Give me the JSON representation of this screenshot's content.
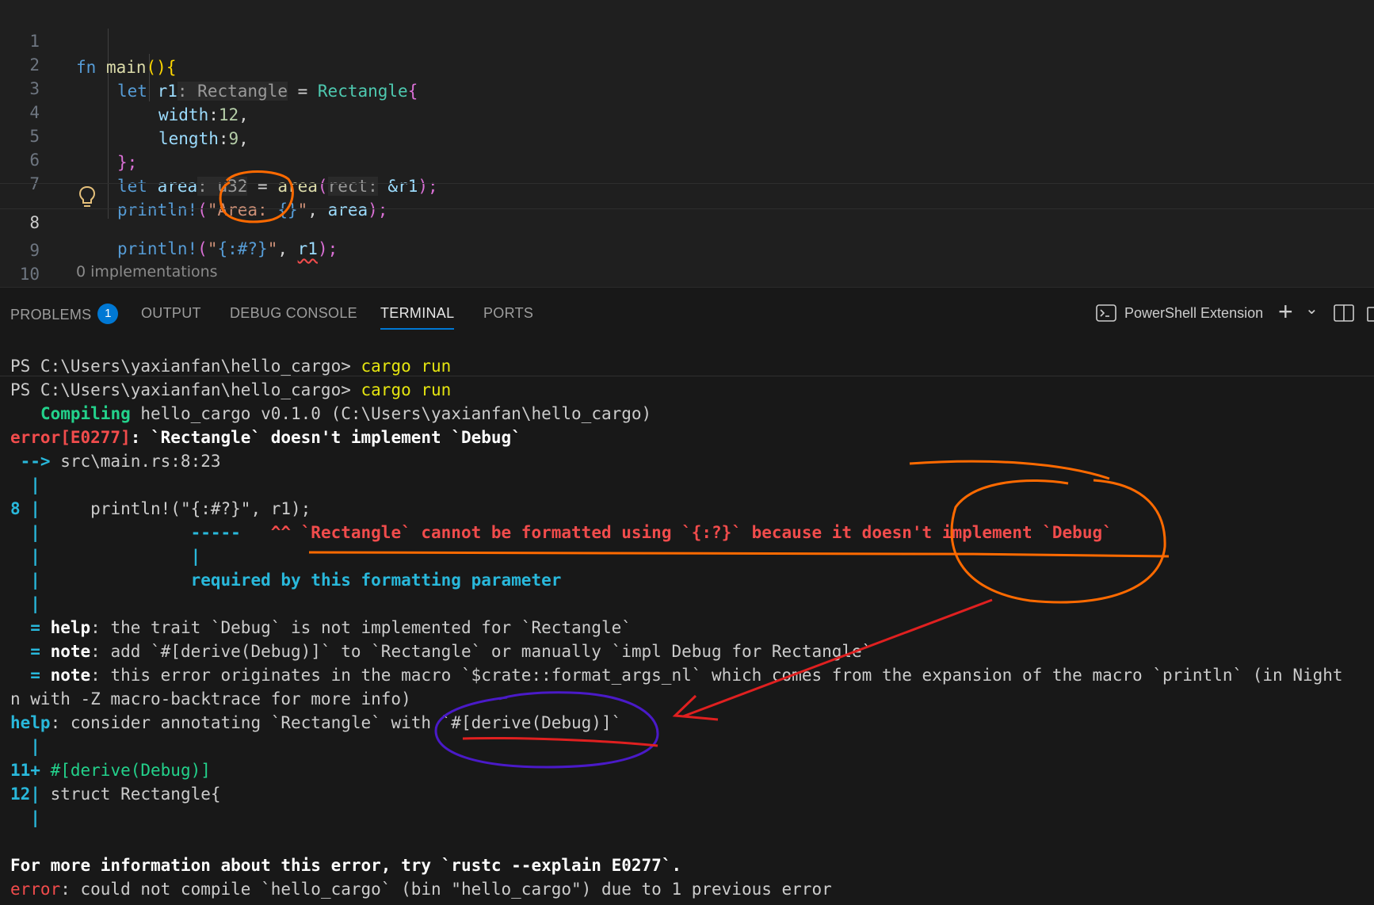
{
  "editor": {
    "line_numbers": [
      "1",
      "2",
      "3",
      "4",
      "5",
      "6",
      "7",
      "8",
      "9",
      "10"
    ],
    "active_line": "8",
    "l1": {
      "kw": "fn",
      "name": "main",
      "open": "(){"
    },
    "l2": {
      "kw": "let",
      "var": "r1",
      "hint": ": Rectangle",
      "eq": " = ",
      "ty": "Rectangle",
      "br": "{"
    },
    "l3": {
      "field": "width",
      "colon": ":",
      "num": "12",
      "comma": ","
    },
    "l4": {
      "field": "length",
      "colon": ":",
      "num": "9",
      "comma": ","
    },
    "l5": {
      "close": "};"
    },
    "l6": {
      "kw": "let",
      "var": "area",
      "hint": ": u32",
      "eq": " = ",
      "fn": "area",
      "hint2": "rect:",
      "arg": " &r1",
      "end": ");"
    },
    "l7": {
      "mac": "println!",
      "open": "(",
      "str": "\"Area: ",
      "esc": "{}",
      "strend": "\"",
      "rest": ", ",
      "var": "area",
      "end": ");"
    },
    "l8": {
      "mac": "println!",
      "open": "(",
      "str": "\"",
      "esc": "{:#?}",
      "strend": "\"",
      "rest": ", ",
      "var": "r1",
      "end": ");"
    },
    "l10": {
      "close": "}"
    },
    "codelens": "0 implementations"
  },
  "panel": {
    "tabs": [
      "PROBLEMS",
      "OUTPUT",
      "DEBUG CONSOLE",
      "TERMINAL",
      "PORTS"
    ],
    "problems_count": "1",
    "active_tab": "TERMINAL",
    "terminal_name": "PowerShell Extension",
    "add_icon": "+",
    "chevron": "⌄"
  },
  "terminal": {
    "prompt": "PS C:\\Users\\yaxianfan\\hello_cargo> ",
    "cmd": "cargo run",
    "compiling_kw": "Compiling",
    "compiling_rest": " hello_cargo v0.1.0 (C:\\Users\\yaxianfan\\hello_cargo)",
    "err_code": "error[E0277]",
    "err_msg": ": `Rectangle` doesn't implement `Debug`",
    "arrow": " --> ",
    "location": "src\\main.rs:8:23",
    "pipe": "  |",
    "src_num": "8 |",
    "src_code": "     println!(\"{:#?}\", r1);",
    "dashes": "               -----   ",
    "carets": "^^ `Rectangle` cannot be formatted using `{:?}` because it doesn't implement `Debug`",
    "sub_pipe": "               |",
    "required": "               required by this formatting parameter",
    "eq": "  = ",
    "help1_kw": "help",
    "help1": ": the trait `Debug` is not implemented for `Rectangle`",
    "note1_kw": "note",
    "note1": ": add `#[derive(Debug)]` to `Rectangle` or manually `impl Debug for Rectangle`",
    "note2_kw": "note",
    "note2": ": this error originates in the macro `$crate::format_args_nl` which comes from the expansion of the macro `println` (in Night",
    "note2_wrap": "n with -Z macro-backtrace for more info)",
    "help2_kw": "help",
    "help2": ": consider annotating `Rectangle` with `#[derive(Debug)]`",
    "s11_num": "11+",
    "s11_code": " #[derive(Debug)]",
    "s12_num": "12|",
    "s12_code": " struct Rectangle{",
    "more_info": "For more information about this error, try `rustc --explain E0277`.",
    "final_kw": "error",
    "final_msg": ": could not compile `hello_cargo` (bin \"hello_cargo\") due to 1 previous error"
  }
}
